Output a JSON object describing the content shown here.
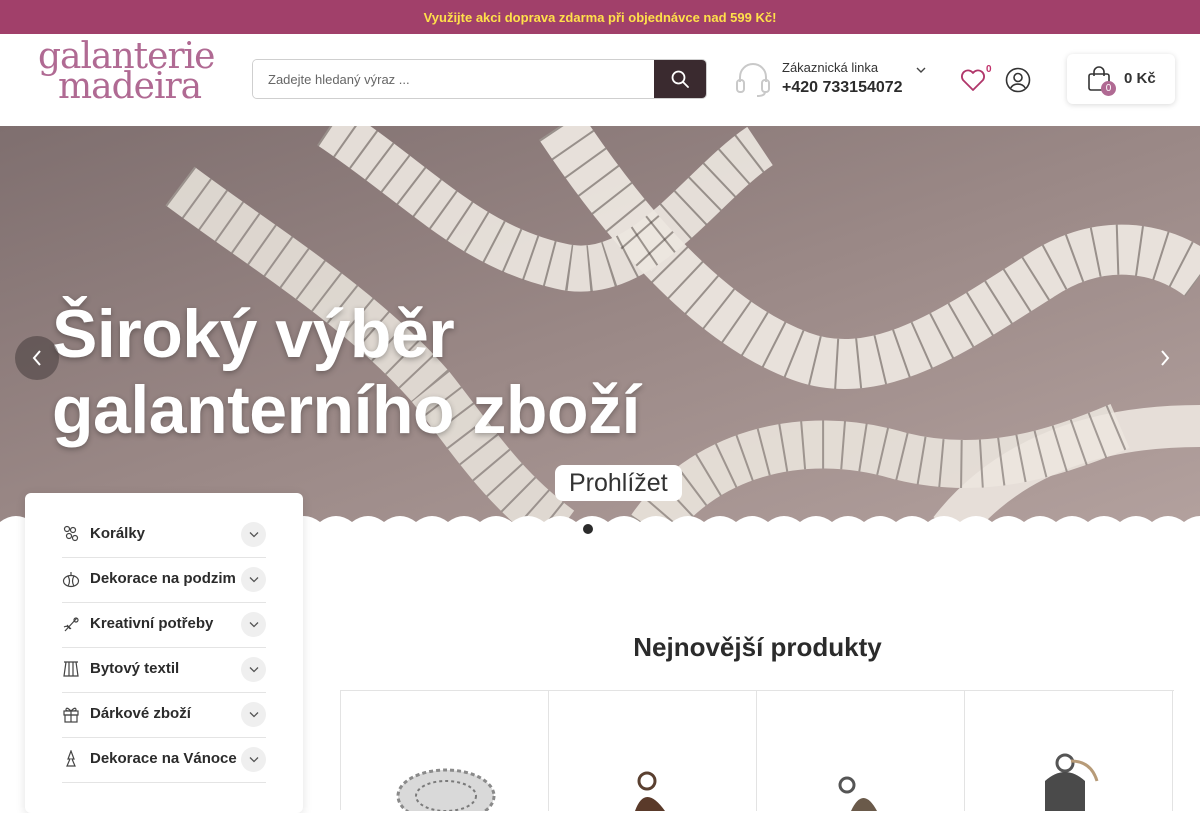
{
  "promo": {
    "text": "Využijte akci doprava zdarma při objednávce nad 599 Kč!"
  },
  "header": {
    "logo": {
      "line1": "galanterie",
      "line2": "madeira"
    },
    "search": {
      "placeholder": "Zadejte hledaný výraz ..."
    },
    "hotline": {
      "label": "Zákaznická linka",
      "phone": "+420 733154072"
    },
    "wishlist": {
      "count": "0"
    },
    "cart": {
      "count": "0",
      "total": "0 Kč"
    }
  },
  "hero": {
    "heading_line1": "Široký výběr",
    "heading_line2": "galanterního zboží",
    "button": "Prohlížet",
    "active_slide": 1,
    "slide_count": 2
  },
  "categories": [
    {
      "label": "Korálky",
      "icon": "beads-icon"
    },
    {
      "label": "Dekorace na podzim",
      "icon": "pumpkin-icon"
    },
    {
      "label": "Kreativní potřeby",
      "icon": "creative-supplies-icon"
    },
    {
      "label": "Bytový textil",
      "icon": "textile-icon"
    },
    {
      "label": "Dárkové zboží",
      "icon": "gift-icon"
    },
    {
      "label": "Dekorace na Vánoce",
      "icon": "christmas-icon"
    }
  ],
  "products_section": {
    "title": "Nejnovější produkty"
  },
  "colors": {
    "promo_bg": "#a1406a",
    "promo_text": "#ffe04a",
    "brand": "#b06a93",
    "dark": "#3a2a2f"
  }
}
